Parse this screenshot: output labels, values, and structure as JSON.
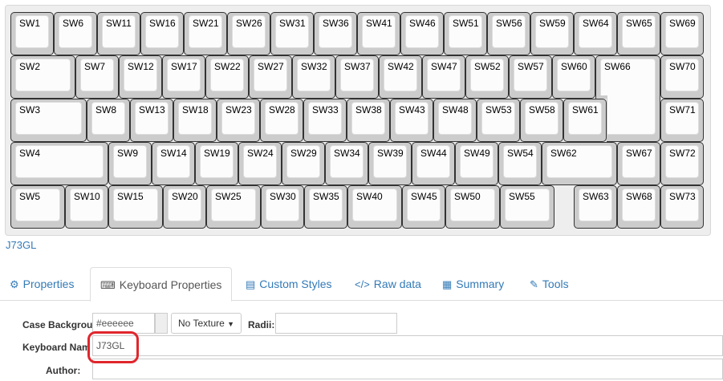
{
  "keyboard": {
    "name_link": "J73GL",
    "keys": [
      "SW1",
      "SW6",
      "SW11",
      "SW16",
      "SW21",
      "SW26",
      "SW31",
      "SW36",
      "SW41",
      "SW46",
      "SW51",
      "SW56",
      "SW59",
      "SW64",
      "SW65",
      "SW69",
      "SW2",
      "SW7",
      "SW12",
      "SW17",
      "SW22",
      "SW27",
      "SW32",
      "SW37",
      "SW42",
      "SW47",
      "SW52",
      "SW57",
      "SW60",
      "SW66",
      "SW70",
      "SW3",
      "SW8",
      "SW13",
      "SW18",
      "SW23",
      "SW28",
      "SW33",
      "SW38",
      "SW43",
      "SW48",
      "SW53",
      "SW58",
      "SW61",
      "SW71",
      "SW4",
      "SW9",
      "SW14",
      "SW19",
      "SW24",
      "SW29",
      "SW34",
      "SW39",
      "SW44",
      "SW49",
      "SW54",
      "SW62",
      "SW67",
      "SW72",
      "SW5",
      "SW10",
      "SW15",
      "SW20",
      "SW25",
      "SW30",
      "SW35",
      "SW40",
      "SW45",
      "SW50",
      "SW55",
      "SW63",
      "SW68",
      "SW73"
    ]
  },
  "tabs": [
    {
      "label": "Properties",
      "icon": "sliders-icon",
      "active": false
    },
    {
      "label": "Keyboard Properties",
      "icon": "keyboard-icon",
      "active": true
    },
    {
      "label": "Custom Styles",
      "icon": "file-icon",
      "active": false
    },
    {
      "label": "Raw data",
      "icon": "code-icon",
      "active": false
    },
    {
      "label": "Summary",
      "icon": "document-icon",
      "active": false
    },
    {
      "label": "Tools",
      "icon": "wrench-icon",
      "active": false
    }
  ],
  "form": {
    "case_background_label": "Case Backgrour",
    "case_background_value": "#eeeeee",
    "texture_select": "No Texture",
    "radii_label": "Radii:",
    "radii_value": "",
    "keyboard_name_label": "Keyboard Nam",
    "keyboard_name_value": "J73GL",
    "author_label": "Author:",
    "author_value": ""
  },
  "colors": {
    "case_background": "#eeeeee",
    "key_cap": "#cccccc",
    "link": "#337ab7",
    "highlight": "#e0262c"
  }
}
